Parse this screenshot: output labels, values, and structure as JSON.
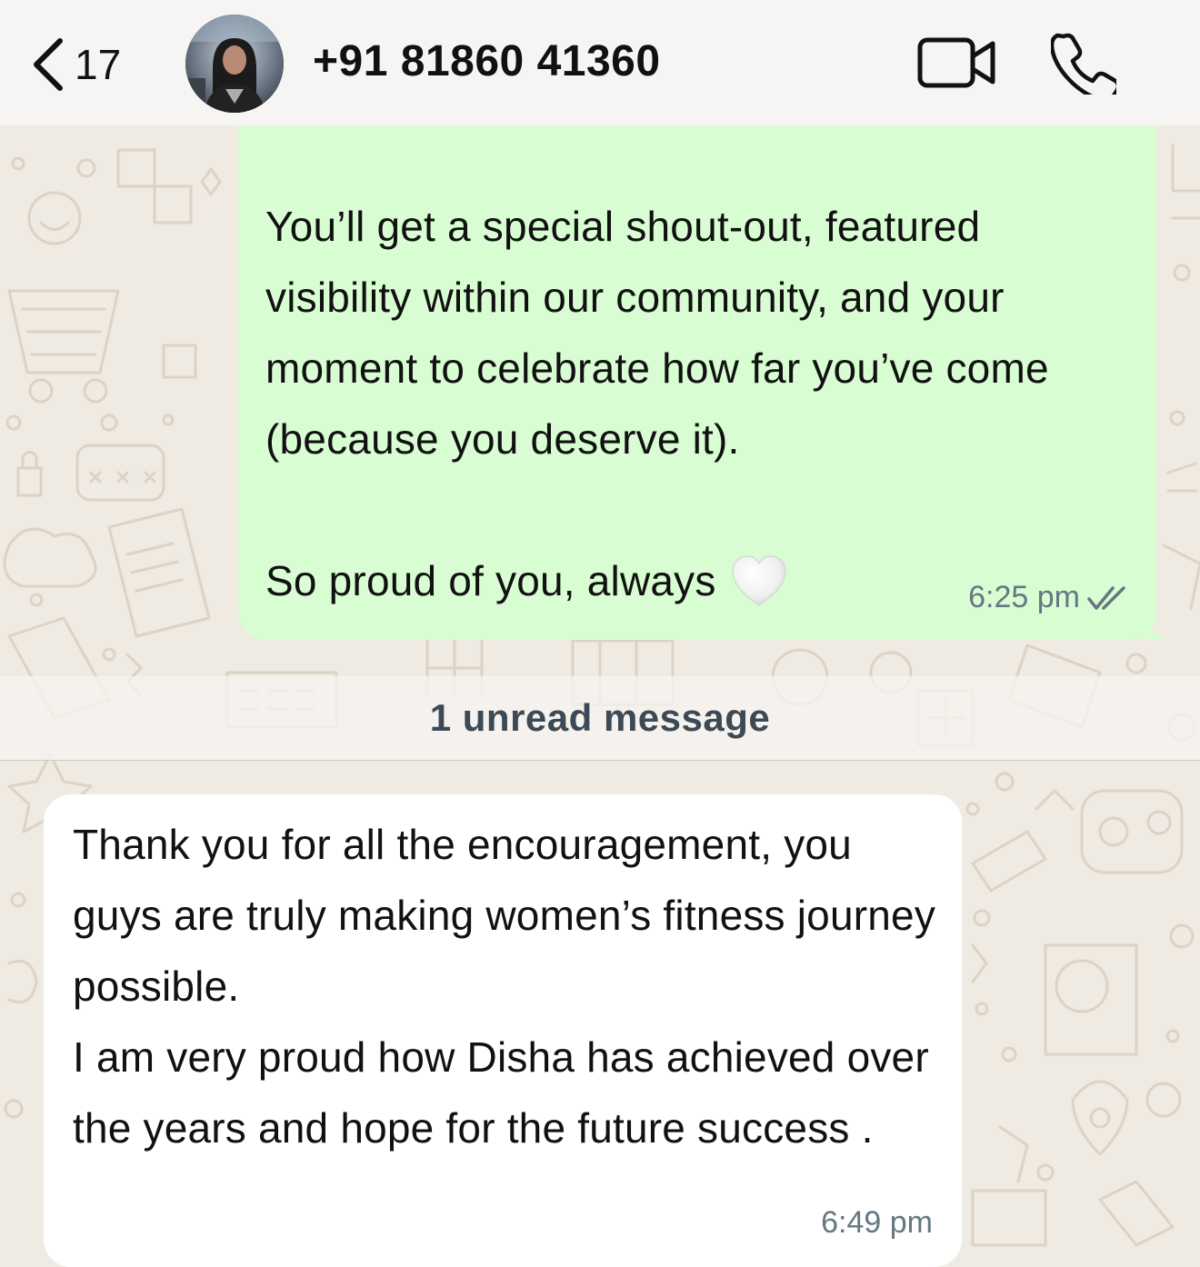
{
  "header": {
    "back_count": "17",
    "contact_name": "+91 81860 41360"
  },
  "messages": {
    "outgoing": {
      "text": "You’ll get a special shout-out, featured visibility within our community, and your moment to celebrate how far you’ve come (because you deserve it).",
      "last_line": "So proud of you, always",
      "emoji": "white-heart-emoji",
      "time": "6:25 pm",
      "status_icon": "double-check-icon"
    },
    "unread_divider": "1 unread message",
    "incoming": {
      "text": "Thank you for all the encouragement, you guys are truly making women’s fitness journey possible.\nI am very proud how Disha has achieved over the years and hope for the future success .",
      "time": "6:49 pm"
    }
  },
  "colors": {
    "chat_background": "#efeae2",
    "outgoing_bubble": "#d9fdd3",
    "incoming_bubble": "#ffffff",
    "header_background": "#f6f5f3",
    "timestamp": "#667781"
  }
}
